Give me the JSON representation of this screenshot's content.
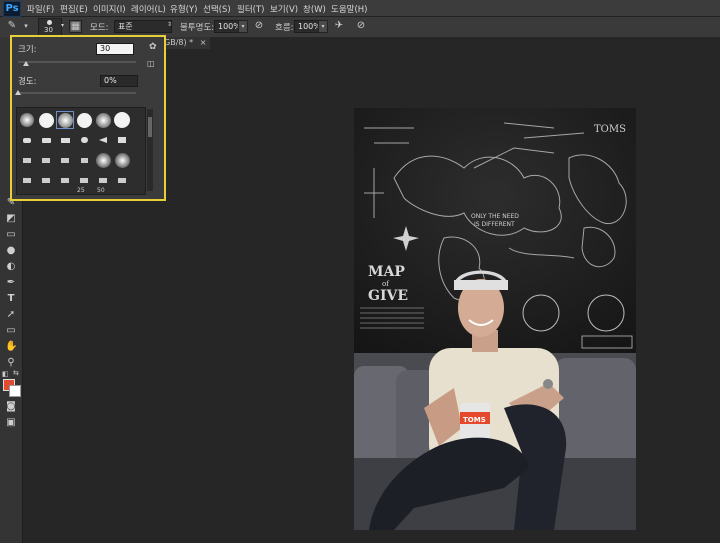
{
  "app": {
    "logo": "Ps"
  },
  "menu": [
    "파일(F)",
    "편집(E)",
    "이미지(I)",
    "레이어(L)",
    "유형(Y)",
    "선택(S)",
    "필터(T)",
    "보기(V)",
    "창(W)",
    "도움말(H)"
  ],
  "options": {
    "brush_size": "30",
    "mode_label": "모드:",
    "mode_value": "표준",
    "opacity_label": "불투명도:",
    "opacity_value": "100%",
    "flow_label": "흐름:",
    "flow_value": "100%"
  },
  "document": {
    "tab_label": "GB/8) *",
    "close": "×"
  },
  "brush_panel": {
    "size_label": "크기:",
    "size_value": "30",
    "size_fraction": 0.07,
    "hardness_label": "경도:",
    "hardness_value": "0%",
    "hardness_fraction": 0.0,
    "preset_numbers": [
      "25",
      "50"
    ]
  },
  "colors": {
    "foreground": "#e14b2f",
    "background": "#ffffff",
    "highlight": "#e8cf3a"
  },
  "photo": {
    "cup_text": "TOMS",
    "wall_texts": [
      "MAP",
      "of",
      "GIVE",
      "ONLY THE NEED",
      "IS DIFFERENT",
      "TOMS"
    ]
  }
}
